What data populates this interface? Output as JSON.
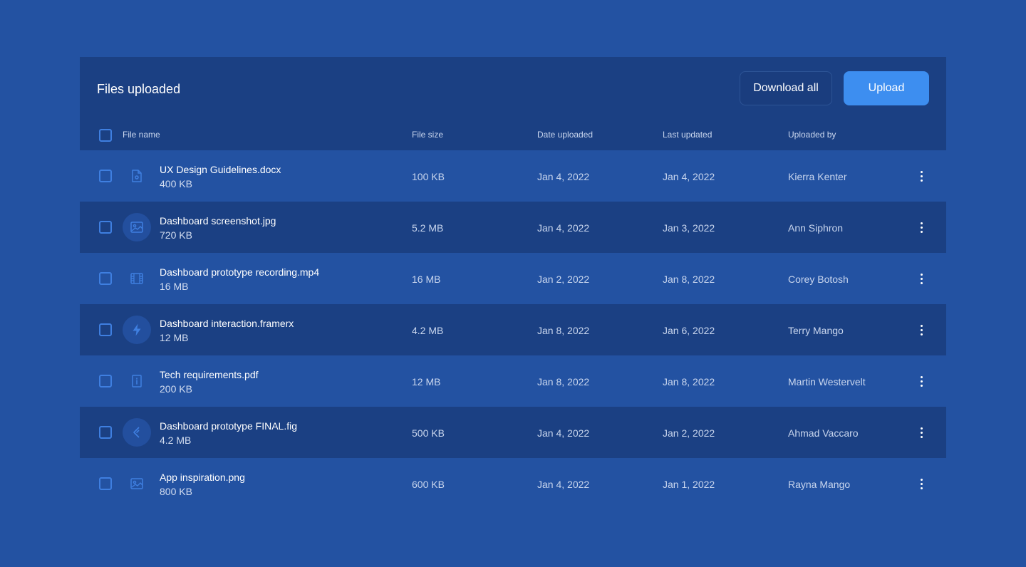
{
  "header": {
    "title": "Files uploaded",
    "download_all_label": "Download all",
    "upload_label": "Upload"
  },
  "columns": {
    "file_name": "File name",
    "file_size": "File size",
    "date_uploaded": "Date uploaded",
    "last_updated": "Last updated",
    "uploaded_by": "Uploaded by"
  },
  "rows": [
    {
      "name": "UX Design Guidelines.docx",
      "sub": "400 KB",
      "size": "100 KB",
      "uploaded": "Jan 4, 2022",
      "updated": "Jan 4, 2022",
      "by": "Kierra Kenter",
      "icon": "document-icon"
    },
    {
      "name": "Dashboard screenshot.jpg",
      "sub": "720 KB",
      "size": "5.2 MB",
      "uploaded": "Jan 4, 2022",
      "updated": "Jan 3, 2022",
      "by": "Ann Siphron",
      "icon": "image-icon"
    },
    {
      "name": "Dashboard prototype recording.mp4",
      "sub": "16 MB",
      "size": "16 MB",
      "uploaded": "Jan 2, 2022",
      "updated": "Jan 8, 2022",
      "by": "Corey Botosh",
      "icon": "film-icon"
    },
    {
      "name": "Dashboard interaction.framerx",
      "sub": "12 MB",
      "size": "4.2 MB",
      "uploaded": "Jan 8, 2022",
      "updated": "Jan 6, 2022",
      "by": "Terry Mango",
      "icon": "lightning-icon"
    },
    {
      "name": "Tech requirements.pdf",
      "sub": "200 KB",
      "size": "12 MB",
      "uploaded": "Jan 8, 2022",
      "updated": "Jan 8, 2022",
      "by": "Martin Westervelt",
      "icon": "pdf-icon"
    },
    {
      "name": "Dashboard prototype FINAL.fig",
      "sub": "4.2 MB",
      "size": "500 KB",
      "uploaded": "Jan 4, 2022",
      "updated": "Jan 2, 2022",
      "by": "Ahmad Vaccaro",
      "icon": "figma-icon"
    },
    {
      "name": "App inspiration.png",
      "sub": "800 KB",
      "size": "600 KB",
      "uploaded": "Jan 4, 2022",
      "updated": "Jan 1, 2022",
      "by": "Rayna Mango",
      "icon": "image-icon"
    }
  ],
  "colors": {
    "background": "#2352a2",
    "panel_dark": "#1b4083",
    "accent": "#3d8ef0",
    "icon": "#3f7fe0"
  }
}
